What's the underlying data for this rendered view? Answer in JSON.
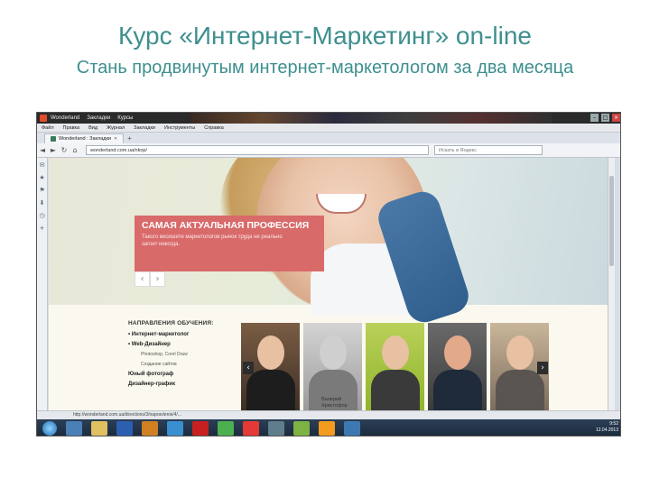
{
  "slide": {
    "title": "Курс «Интернет-Маркетинг» on-line",
    "subtitle": "Стань продвинутым интернет-маркетологом за два месяца"
  },
  "window": {
    "title_tabs": [
      "Wonderland",
      "Закладки",
      "Курсы"
    ],
    "controls": [
      "–",
      "□",
      "×"
    ]
  },
  "menubar": {
    "items": [
      "Файл",
      "Правка",
      "Вид",
      "Журнал",
      "Закладки",
      "Инструменты",
      "Справка"
    ]
  },
  "tabs": [
    {
      "label": "Wonderland : Закладки"
    }
  ],
  "newtab_label": "+",
  "navbar": {
    "back": "◄",
    "forward": "►",
    "reload": "↻",
    "home": "⌂",
    "url": "wonderland.com.ua/nkop/",
    "search_placeholder": "Искать в Яндекс"
  },
  "sidebar": {
    "icons": [
      "mail-icon",
      "star-icon",
      "bookmark-icon",
      "download-icon",
      "history-icon",
      "add-icon"
    ],
    "glyphs": [
      "✉",
      "★",
      "⚑",
      "⬇",
      "◷",
      "+"
    ]
  },
  "hero": {
    "heading": "САМАЯ АКТУАЛЬНАЯ ПРОФЕССИЯ",
    "text": "Такого весишите маркетологов рынок труда не реально загоет никогда.",
    "prev": "‹",
    "next": "›"
  },
  "directions": {
    "title": "НАПРАВЛЕНИЯ ОБУЧЕНИЯ:",
    "items": [
      {
        "label": "• Интернет-маркетолог"
      },
      {
        "label": "• Web-Дизайнер"
      }
    ],
    "subitems": [
      "Photoshop, Corel Draw",
      "Создание сайтов"
    ],
    "extra": [
      "Юный фотограф",
      "Дизайнер-график"
    ]
  },
  "photos": {
    "caption": "Валерий\nХристофор",
    "prev": "‹",
    "next": "›"
  },
  "statusbar": {
    "text": "http://wonderland.com.ua/directions/3/napravlenie/4/..."
  },
  "taskbar": {
    "time": "9:52",
    "date": "12.04.2013"
  },
  "colors": {
    "title_teal": "#3f8f8f",
    "promo_red": "#d96a6a"
  }
}
